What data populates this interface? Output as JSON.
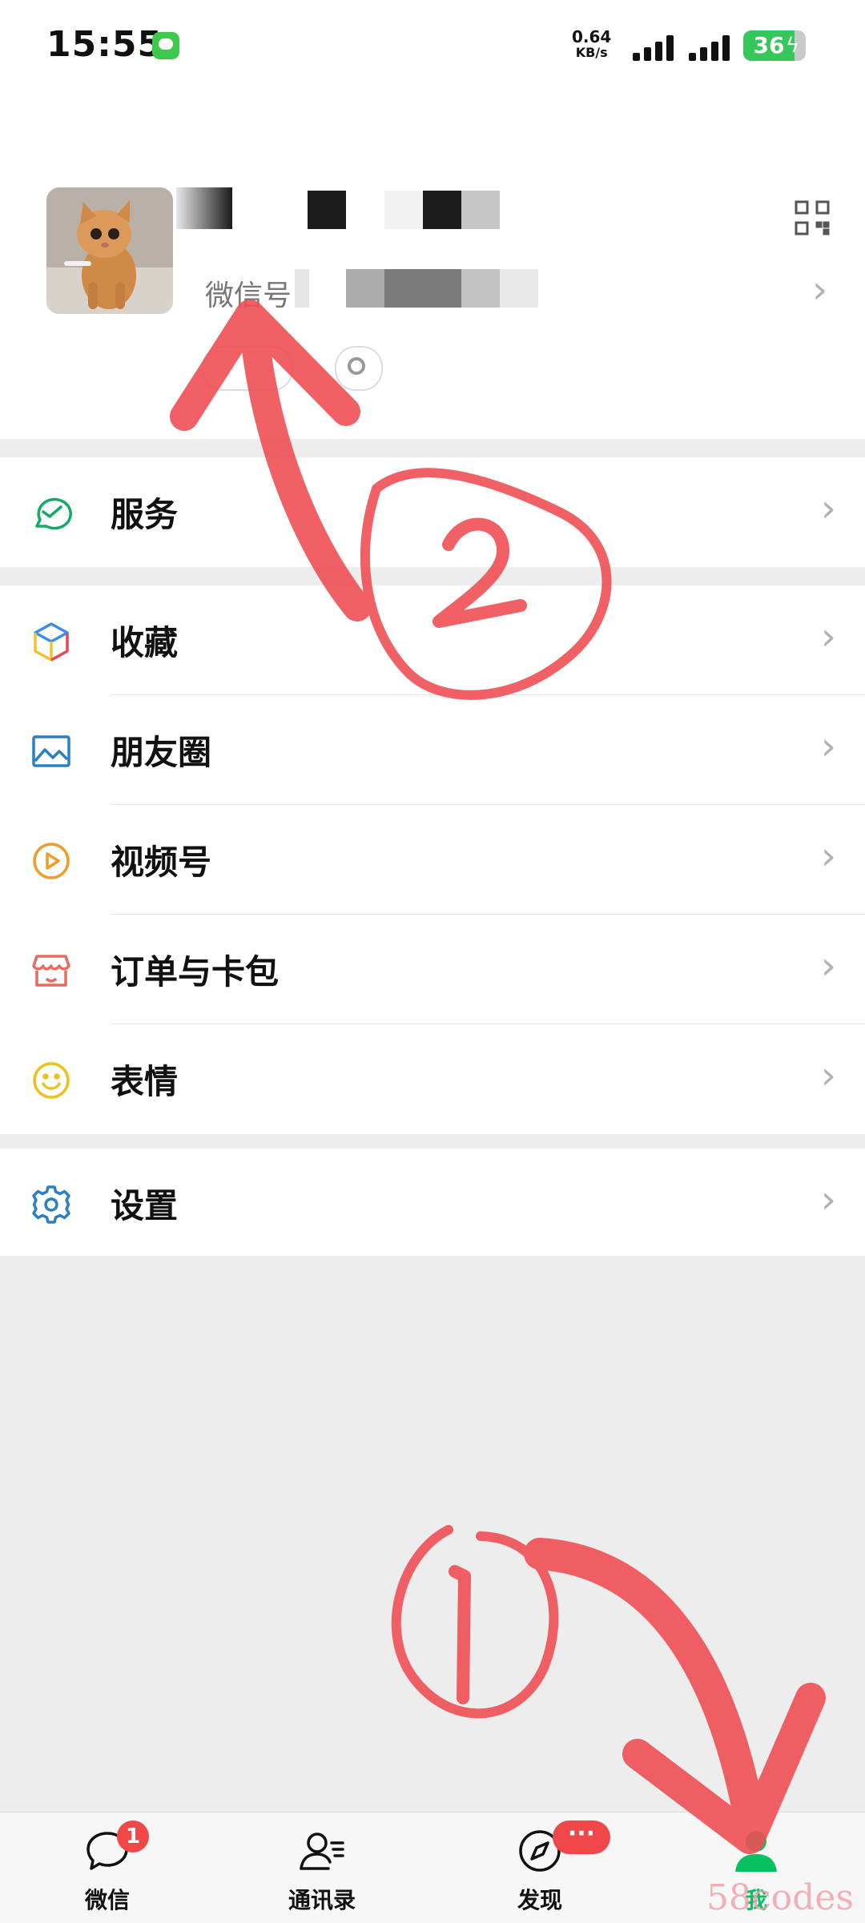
{
  "status_bar": {
    "time": "15:55",
    "net_speed_value": "0.64",
    "net_speed_unit": "KB/s",
    "battery_level": "36",
    "battery_percent": 36
  },
  "profile": {
    "wechat_id_label": "微信号"
  },
  "menu": {
    "service": "服务",
    "favorites": "收藏",
    "moments": "朋友圈",
    "channels": "视频号",
    "orders": "订单与卡包",
    "stickers": "表情",
    "settings": "设置"
  },
  "tabbar": {
    "chats": {
      "label": "微信",
      "badge": "1"
    },
    "contacts": {
      "label": "通讯录"
    },
    "discover": {
      "label": "发现",
      "badge": "···"
    },
    "me": {
      "label": "我",
      "active": true
    }
  },
  "annotations": {
    "step1": "1",
    "step2": "2"
  },
  "watermark": "58codes",
  "colors": {
    "accent": "#07c160",
    "badge": "#f04848",
    "annotation": "#ef4f55"
  }
}
